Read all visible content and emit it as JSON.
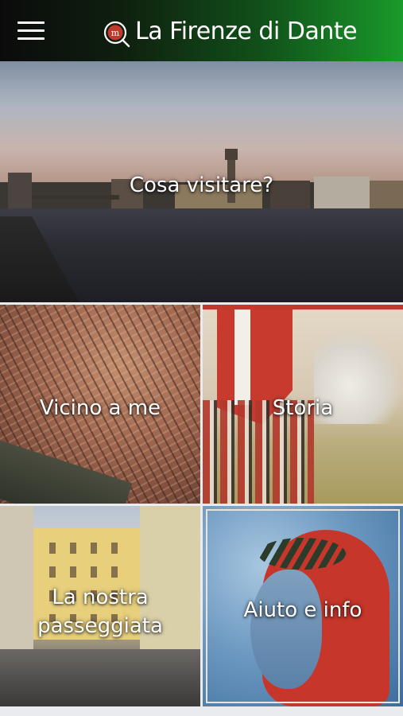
{
  "header": {
    "title": "La Firenze di Dante",
    "menu_icon": "hamburger-menu-icon",
    "logo_icon": "dante-logo-icon",
    "logo_letter": "m"
  },
  "tiles": [
    {
      "id": "visit",
      "label": "Cosa visitare?"
    },
    {
      "id": "near",
      "label": "Vicino a me"
    },
    {
      "id": "history",
      "label": "Storia"
    },
    {
      "id": "walk",
      "label": "La nostra passeggiata"
    },
    {
      "id": "help",
      "label": "Aiuto e info"
    }
  ],
  "colors": {
    "header_gradient_start": "#0b0b0b",
    "header_gradient_end": "#1a9a2a",
    "logo_red": "#c0392b",
    "text": "#ffffff"
  }
}
